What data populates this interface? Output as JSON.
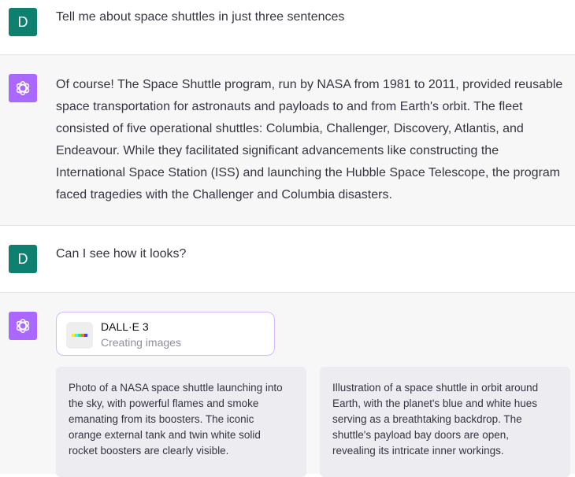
{
  "conversation": [
    {
      "role": "user",
      "avatar_letter": "D",
      "text": "Tell me about space shuttles in just three sentences"
    },
    {
      "role": "assistant",
      "lines": [
        "Of course! The Space Shuttle program, run by NASA from 1981 to 2011, provided reusable",
        "space transportation for astronauts and payloads to and from Earth's orbit. The fleet",
        "consisted of five operational shuttles: Columbia, Challenger, Discovery, Atlantis, and",
        "Endeavour. While they facilitated significant advancements like constructing the",
        "International Space Station (ISS) and launching the Hubble Space Telescope, the program",
        "faced tragedies with the Challenger and Columbia disasters."
      ]
    },
    {
      "role": "user",
      "avatar_letter": "D",
      "text": "Can I see how it looks?"
    },
    {
      "role": "assistant",
      "tool": {
        "name": "DALL·E 3",
        "status": "Creating images"
      },
      "prompts": [
        {
          "lines": [
            "Photo of a NASA space shuttle launching into",
            "the sky, with powerful flames and smoke",
            "emanating from its boosters. The iconic",
            "orange external tank and twin white solid",
            "rocket boosters are clearly visible."
          ]
        },
        {
          "lines": [
            "Illustration of a space shuttle in orbit around",
            "Earth, with the planet's blue and white hues",
            "serving as a breathtaking backdrop. The",
            "shuttle's payload bay doors are open,",
            "revealing its intricate inner workings."
          ]
        }
      ]
    }
  ],
  "colors": {
    "user_avatar": "#0e8070",
    "assistant_avatar": "#ab68ff",
    "assistant_bg": "#f7f7f8",
    "tool_card_border": "#d9b7fb"
  },
  "icons": {
    "assistant": "openai-logo-icon",
    "dalle": "dalle-palette-icon"
  }
}
